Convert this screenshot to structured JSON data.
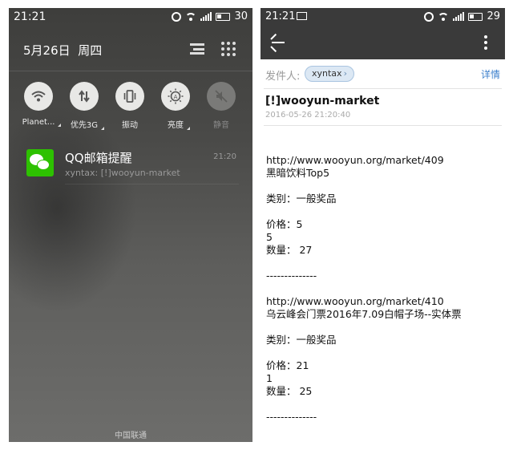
{
  "left": {
    "status": {
      "time": "21:21",
      "battery": "30"
    },
    "date": "5月26日",
    "weekday": "周四",
    "toggles": [
      {
        "label": "Planet...",
        "icon": "wifi-icon",
        "state": "on"
      },
      {
        "label": "优先3G",
        "icon": "data-transfer-icon",
        "state": "on"
      },
      {
        "label": "振动",
        "icon": "vibrate-icon",
        "state": "on"
      },
      {
        "label": "亮度",
        "icon": "brightness-icon",
        "state": "on"
      },
      {
        "label": "静音",
        "icon": "mute-icon",
        "state": "off"
      }
    ],
    "notification": {
      "title": "QQ邮箱提醒",
      "preview": "xyntax: [!]wooyun-market",
      "time": "21:20",
      "app_icon": "wechat-icon"
    },
    "carrier": "中国联通"
  },
  "right": {
    "status": {
      "time": "21:21",
      "battery": "29"
    },
    "sender_label": "发件人:",
    "sender": "xyntax",
    "details_link": "详情",
    "subject": "[!]wooyun-market",
    "datetime": "2016-05-26 21:20:40",
    "body_lines": [
      "http://www.wooyun.org/market/409",
      "黑暗饮料Top5",
      "",
      "类别：一般奖品",
      "",
      "价格：5",
      "5",
      "数量： 27",
      "",
      "--------------",
      "",
      "http://www.wooyun.org/market/410",
      "乌云峰会门票2016年7.09白帽子场--实体票",
      "",
      "类别：一般奖品",
      "",
      "价格：21",
      "1",
      "数量： 25",
      "",
      "--------------"
    ]
  },
  "colors": {
    "toolbar": "#3a3a3a",
    "link": "#3b7fcc",
    "chip_bg": "#dce8f4",
    "wechat_green": "#2dc100"
  }
}
